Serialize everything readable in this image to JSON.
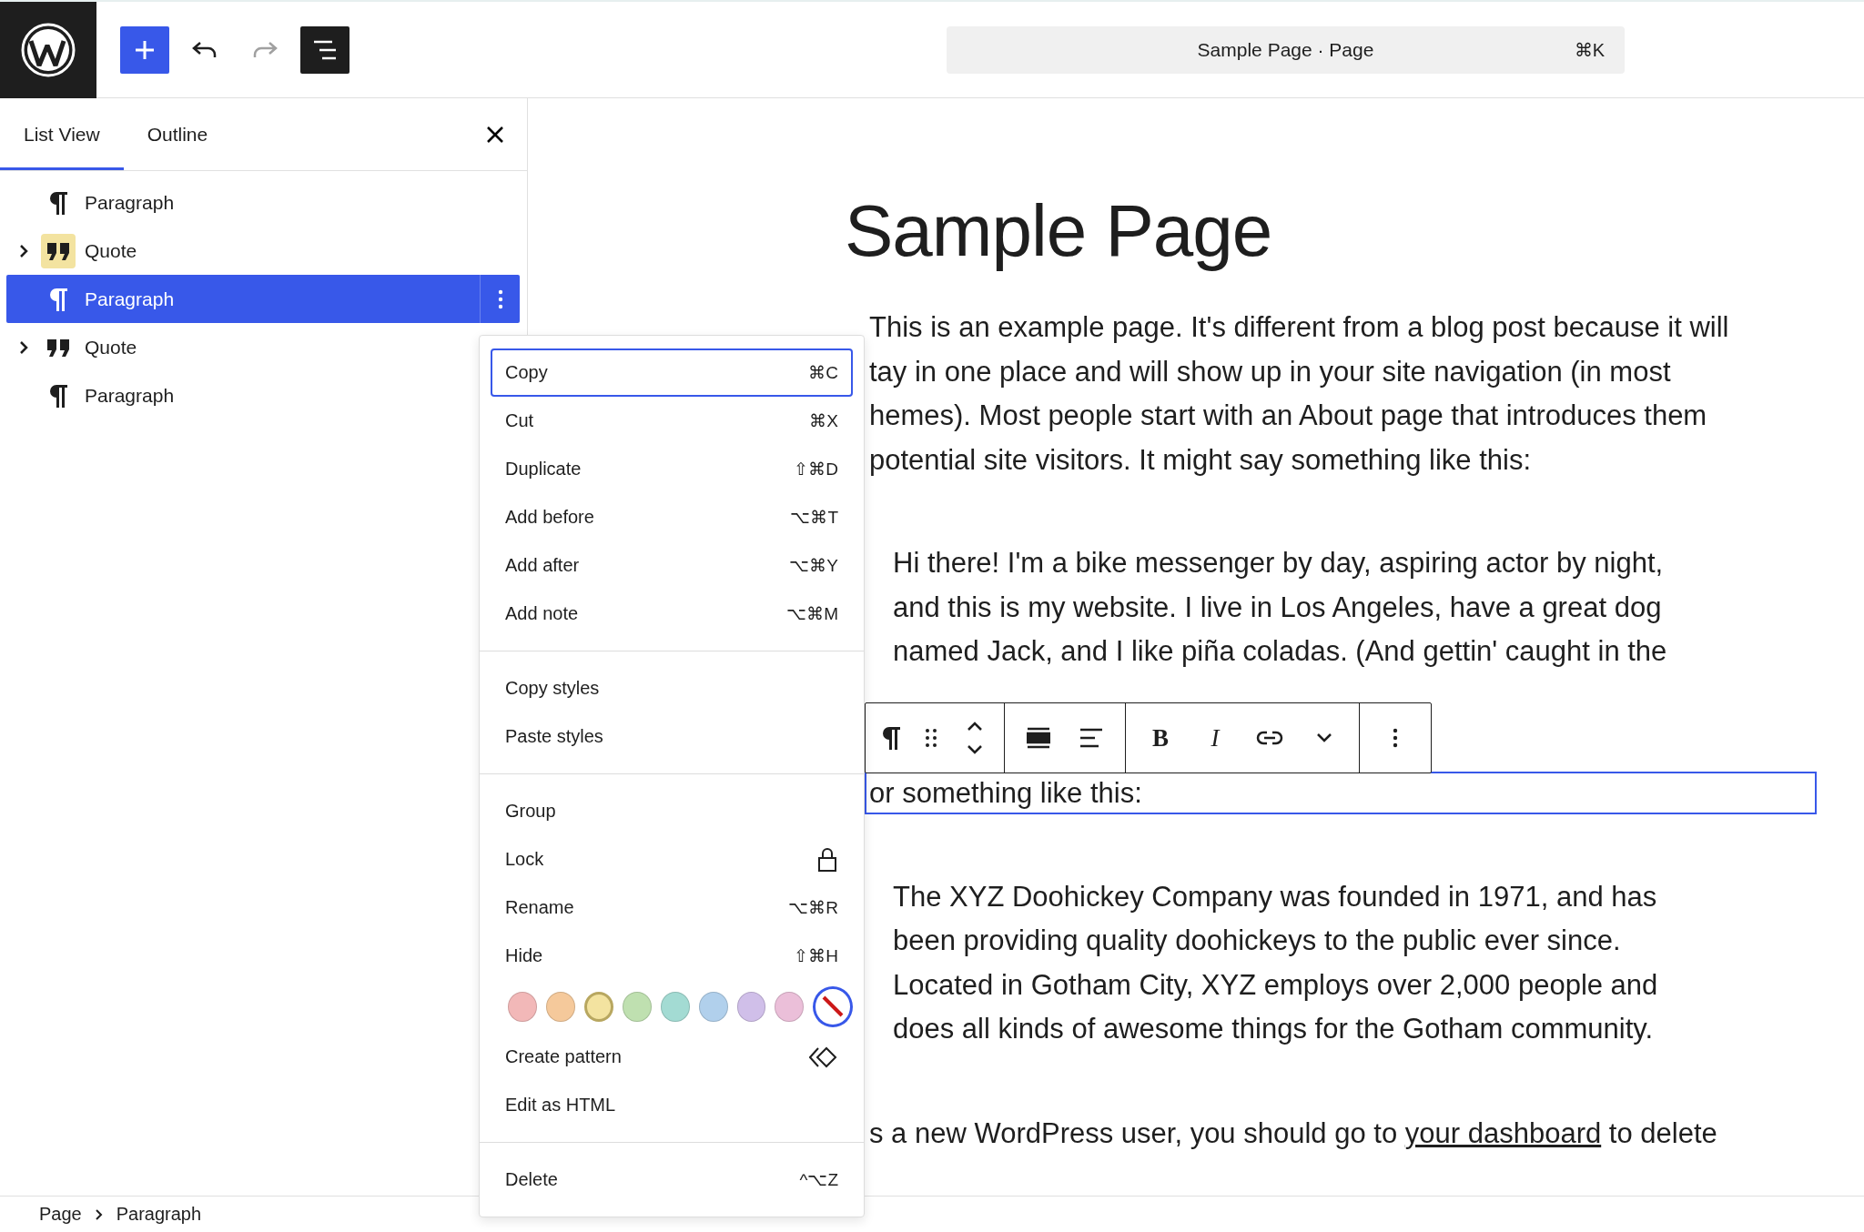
{
  "header": {
    "command_bar": {
      "title": "Sample Page · Page",
      "shortcut": "⌘K"
    },
    "list_view_toggle": {
      "on": true
    },
    "redo": {
      "disabled": true
    }
  },
  "sidebar": {
    "tabs": [
      {
        "label": "List View",
        "selected": true
      },
      {
        "label": "Outline",
        "selected": false
      }
    ],
    "items": [
      {
        "label": "Paragraph",
        "kind": "paragraph",
        "selected": false
      },
      {
        "label": "Quote",
        "kind": "quote",
        "selected": false,
        "expanded": false,
        "color": "#f3e3a0"
      },
      {
        "label": "Paragraph",
        "kind": "paragraph",
        "selected": true
      },
      {
        "label": "Quote",
        "kind": "quote",
        "selected": false,
        "expanded": false
      },
      {
        "label": "Paragraph",
        "kind": "paragraph",
        "selected": false
      }
    ]
  },
  "editor": {
    "title": "Sample Page",
    "blocks": [
      {
        "kind": "paragraph",
        "selected": false,
        "lines": [
          "This is an example page. It's different from a blog post because it will",
          "tay in one place and will show up in your site navigation (in most",
          "hemes). Most people start with an About page that introduces them",
          "potential site visitors. It might say something like this:"
        ]
      },
      {
        "kind": "quote",
        "selected": false,
        "lines": [
          "Hi there! I'm a bike messenger by day, aspiring actor by night,",
          "and this is my website. I live in Los Angeles, have a great dog",
          "named Jack, and I like piña coladas. (And gettin' caught in the"
        ]
      },
      {
        "kind": "paragraph",
        "selected": true,
        "lines": [
          "or something like this:"
        ]
      },
      {
        "kind": "quote",
        "selected": false,
        "lines": [
          "The XYZ Doohickey Company was founded in 1971, and has",
          "been providing quality doohickeys to the public ever since.",
          "Located in Gotham City, XYZ employs over 2,000 people and",
          "does all kinds of awesome things for the Gotham community."
        ]
      },
      {
        "kind": "linked",
        "selected": false,
        "parts": [
          "s a new WordPress user, you should go to",
          "your dashboard",
          "to delete"
        ]
      }
    ]
  },
  "toolbar": {
    "bold": "B",
    "italic": "I"
  },
  "menu": {
    "groups": [
      [
        {
          "kind": "shortcut",
          "label": "Copy",
          "shortcut": "⌘C",
          "focused": true
        },
        {
          "kind": "shortcut",
          "label": "Cut",
          "shortcut": "⌘X",
          "focused": false
        },
        {
          "kind": "shortcut",
          "label": "Duplicate",
          "shortcut": "⇧⌘D",
          "focused": false
        },
        {
          "kind": "shortcut",
          "label": "Add before",
          "shortcut": "⌥⌘T",
          "focused": false
        },
        {
          "kind": "shortcut",
          "label": "Add after",
          "shortcut": "⌥⌘Y",
          "focused": false
        },
        {
          "kind": "shortcut",
          "label": "Add note",
          "shortcut": "⌥⌘M",
          "focused": false
        }
      ],
      [
        {
          "kind": "plain",
          "label": "Copy styles",
          "focused": false
        },
        {
          "kind": "plain",
          "label": "Paste styles",
          "focused": false
        }
      ],
      [
        {
          "kind": "plain",
          "label": "Group",
          "focused": false
        },
        {
          "kind": "lock",
          "label": "Lock",
          "focused": false
        },
        {
          "kind": "shortcut",
          "label": "Rename",
          "shortcut": "⌥⌘R",
          "focused": false
        },
        {
          "kind": "shortcut",
          "label": "Hide",
          "shortcut": "⇧⌘H",
          "focused": false
        },
        {
          "kind": "colors",
          "swatches": [
            {
              "color": "#f2b8b8",
              "selected": false
            },
            {
              "color": "#f5c99b",
              "selected": false
            },
            {
              "color": "#f3e3a0",
              "selected": true
            },
            {
              "color": "#bfe0b0",
              "selected": false
            },
            {
              "color": "#a3dbd3",
              "selected": false
            },
            {
              "color": "#b1d0ec",
              "selected": false
            },
            {
              "color": "#d0bfe9",
              "selected": false
            },
            {
              "color": "#ebbfd9",
              "selected": false
            }
          ],
          "none_focused": true
        },
        {
          "kind": "pattern",
          "label": "Create pattern",
          "focused": false
        },
        {
          "kind": "plain",
          "label": "Edit as HTML",
          "focused": false
        }
      ],
      [
        {
          "kind": "shortcut",
          "label": "Delete",
          "shortcut": "^⌥Z",
          "focused": false
        }
      ]
    ]
  },
  "breadcrumb": [
    "Page",
    "Paragraph"
  ]
}
